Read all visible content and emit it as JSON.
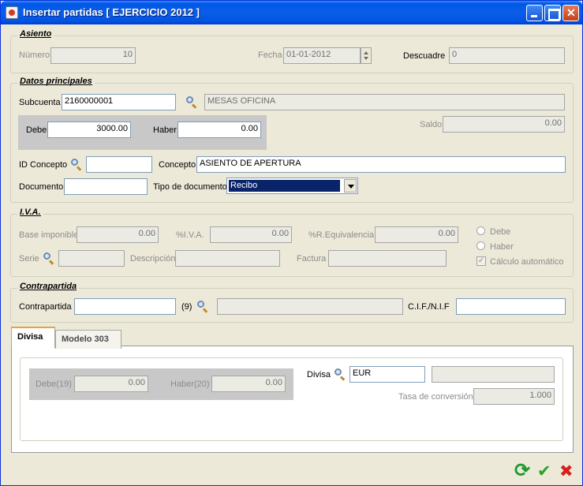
{
  "window": {
    "title": "Insertar partidas [ EJERCICIO 2012 ]"
  },
  "asiento": {
    "legend": "Asiento",
    "numero_label": "Número",
    "numero_value": "10",
    "fecha_label": "Fecha",
    "fecha_value": "01-01-2012",
    "descuadre_label": "Descuadre",
    "descuadre_value": "0"
  },
  "datos": {
    "legend": "Datos principales",
    "subcuenta_label": "Subcuenta",
    "subcuenta_value": "2160000001",
    "subcuenta_desc": "MESAS OFICINA",
    "debe_label": "Debe",
    "debe_value": "3000.00",
    "haber_label": "Haber",
    "haber_value": "0.00",
    "saldo_label": "Saldo",
    "saldo_value": "0.00",
    "id_concepto_label": "ID Concepto",
    "id_concepto_value": "",
    "concepto_label": "Concepto",
    "concepto_value": "ASIENTO DE APERTURA",
    "documento_label": "Documento",
    "documento_value": "",
    "tipo_doc_label": "Tipo de documento",
    "tipo_doc_value": "Recibo"
  },
  "iva": {
    "legend": "I.V.A.",
    "base_label": "Base imponible",
    "base_value": "0.00",
    "pct_iva_label": "%I.V.A.",
    "pct_iva_value": "0.00",
    "pct_req_label": "%R.Equivalencia",
    "pct_req_value": "0.00",
    "debe_radio": "Debe",
    "haber_radio": "Haber",
    "calculo_label": "Cálculo automático",
    "serie_label": "Serie",
    "serie_value": "",
    "descripcion_label": "Descripción",
    "descripcion_value": "",
    "factura_label": "Factura",
    "factura_value": ""
  },
  "contrapartida": {
    "legend": "Contrapartida",
    "label": "Contrapartida",
    "value": "",
    "count": "(9)",
    "desc_value": "",
    "cif_label": "C.I.F./N.I.F",
    "cif_value": ""
  },
  "tabs": [
    {
      "label": "Divisa"
    },
    {
      "label": "Modelo 303"
    }
  ],
  "divisa": {
    "debe_label": "Debe(19)",
    "debe_value": "0.00",
    "haber_label": "Haber(20)",
    "haber_value": "0.00",
    "divisa_label": "Divisa",
    "divisa_value": "EUR",
    "divisa_desc": "",
    "tasa_label": "Tasa de conversión",
    "tasa_value": "1.000"
  },
  "colors": {
    "titlebar": "#0054e3",
    "background": "#ece9d8",
    "selection": "#0a246a"
  },
  "icons": [
    "refresh-icon",
    "check-icon",
    "close-icon"
  ]
}
